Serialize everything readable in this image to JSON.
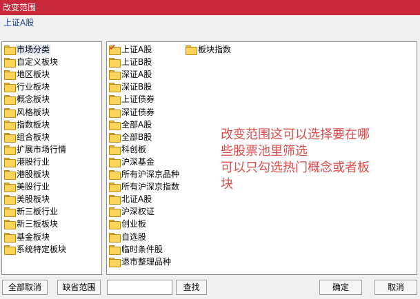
{
  "window": {
    "title": "改变范围"
  },
  "current_selection": "上证A股",
  "categories": [
    {
      "label": "市场分类",
      "selected": true
    },
    {
      "label": "自定义板块"
    },
    {
      "label": "地区板块"
    },
    {
      "label": "行业板块"
    },
    {
      "label": "概念板块"
    },
    {
      "label": "风格板块"
    },
    {
      "label": "指数板块"
    },
    {
      "label": "组合板块"
    },
    {
      "label": "扩展市场行情"
    },
    {
      "label": "港股行业"
    },
    {
      "label": "港股板块"
    },
    {
      "label": "美股行业"
    },
    {
      "label": "美股板块"
    },
    {
      "label": "新三板行业"
    },
    {
      "label": "新三板板块"
    },
    {
      "label": "基金板块"
    },
    {
      "label": "系统特定板块"
    }
  ],
  "markets_col1": [
    {
      "label": "上证A股",
      "checked": true
    },
    {
      "label": "上证B股"
    },
    {
      "label": "深证A股"
    },
    {
      "label": "深证B股"
    },
    {
      "label": "上证债券"
    },
    {
      "label": "深证债券"
    },
    {
      "label": "全部A股"
    },
    {
      "label": "全部B股"
    },
    {
      "label": "科创板"
    },
    {
      "label": "沪深基金"
    },
    {
      "label": "所有沪深京品种"
    },
    {
      "label": "所有沪深京指数"
    },
    {
      "label": "北证A股"
    },
    {
      "label": "沪深权证"
    },
    {
      "label": "创业板"
    },
    {
      "label": "自选股"
    },
    {
      "label": "临时条件股"
    },
    {
      "label": "退市整理品种"
    }
  ],
  "markets_col2": [
    {
      "label": "板块指数"
    }
  ],
  "annotation": {
    "lines": [
      "改变范围这可以选择要在哪",
      "些股票池里筛选",
      "可以只勾选热门概念或者板",
      "块"
    ]
  },
  "buttons": {
    "select_all": "全部取消",
    "default_range": "缺省范围",
    "search": "查找",
    "ok": "确定",
    "cancel": "取消"
  },
  "search": {
    "value": ""
  }
}
